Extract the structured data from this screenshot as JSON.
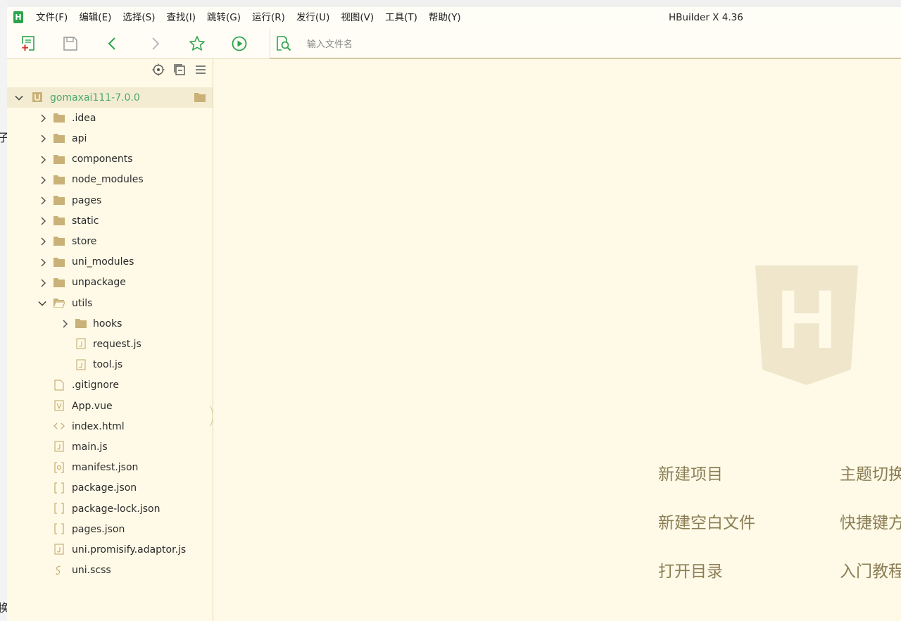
{
  "app": {
    "title": "HBuilder X 4.36",
    "logo": "H"
  },
  "menu": [
    "文件(F)",
    "编辑(E)",
    "选择(S)",
    "查找(I)",
    "跳转(G)",
    "运行(R)",
    "发行(U)",
    "视图(V)",
    "工具(T)",
    "帮助(Y)"
  ],
  "toolbar": {
    "icons": [
      "new-file-icon",
      "save-icon",
      "back-icon",
      "forward-icon",
      "favorite-star-icon",
      "run-icon",
      "file-search-icon"
    ],
    "search_placeholder": "输入文件名"
  },
  "sidebar": {
    "tool_icons": [
      "locate-icon",
      "collapse-all-icon",
      "menu-icon"
    ],
    "tree": [
      {
        "label": "gomaxai111-7.0.0",
        "type": "project",
        "expanded": true
      },
      {
        "label": ".idea",
        "type": "folder"
      },
      {
        "label": "api",
        "type": "folder"
      },
      {
        "label": "components",
        "type": "folder"
      },
      {
        "label": "node_modules",
        "type": "folder"
      },
      {
        "label": "pages",
        "type": "folder"
      },
      {
        "label": "static",
        "type": "folder"
      },
      {
        "label": "store",
        "type": "folder"
      },
      {
        "label": "uni_modules",
        "type": "folder"
      },
      {
        "label": "unpackage",
        "type": "folder"
      },
      {
        "label": "utils",
        "type": "folder",
        "expanded": true
      },
      {
        "label": "hooks",
        "type": "folder"
      },
      {
        "label": "request.js",
        "type": "js"
      },
      {
        "label": "tool.js",
        "type": "js"
      },
      {
        "label": ".gitignore",
        "type": "file"
      },
      {
        "label": "App.vue",
        "type": "vue"
      },
      {
        "label": "index.html",
        "type": "html"
      },
      {
        "label": "main.js",
        "type": "js"
      },
      {
        "label": "manifest.json",
        "type": "manifest"
      },
      {
        "label": "package.json",
        "type": "json"
      },
      {
        "label": "package-lock.json",
        "type": "json"
      },
      {
        "label": "pages.json",
        "type": "json"
      },
      {
        "label": "uni.promisify.adaptor.js",
        "type": "js"
      },
      {
        "label": "uni.scss",
        "type": "scss"
      }
    ]
  },
  "welcome": {
    "watermark_letter": "H",
    "links_left": [
      "新建项目",
      "新建空白文件",
      "打开目录"
    ],
    "links_right": [
      "主题切换",
      "快捷键方",
      "入门教程"
    ]
  },
  "colors": {
    "accent_green": "#2da44e",
    "project_label": "#4da86b",
    "folder": "#c9b178",
    "link_text": "#8b7e55",
    "watermark": "#efe6cc"
  }
}
